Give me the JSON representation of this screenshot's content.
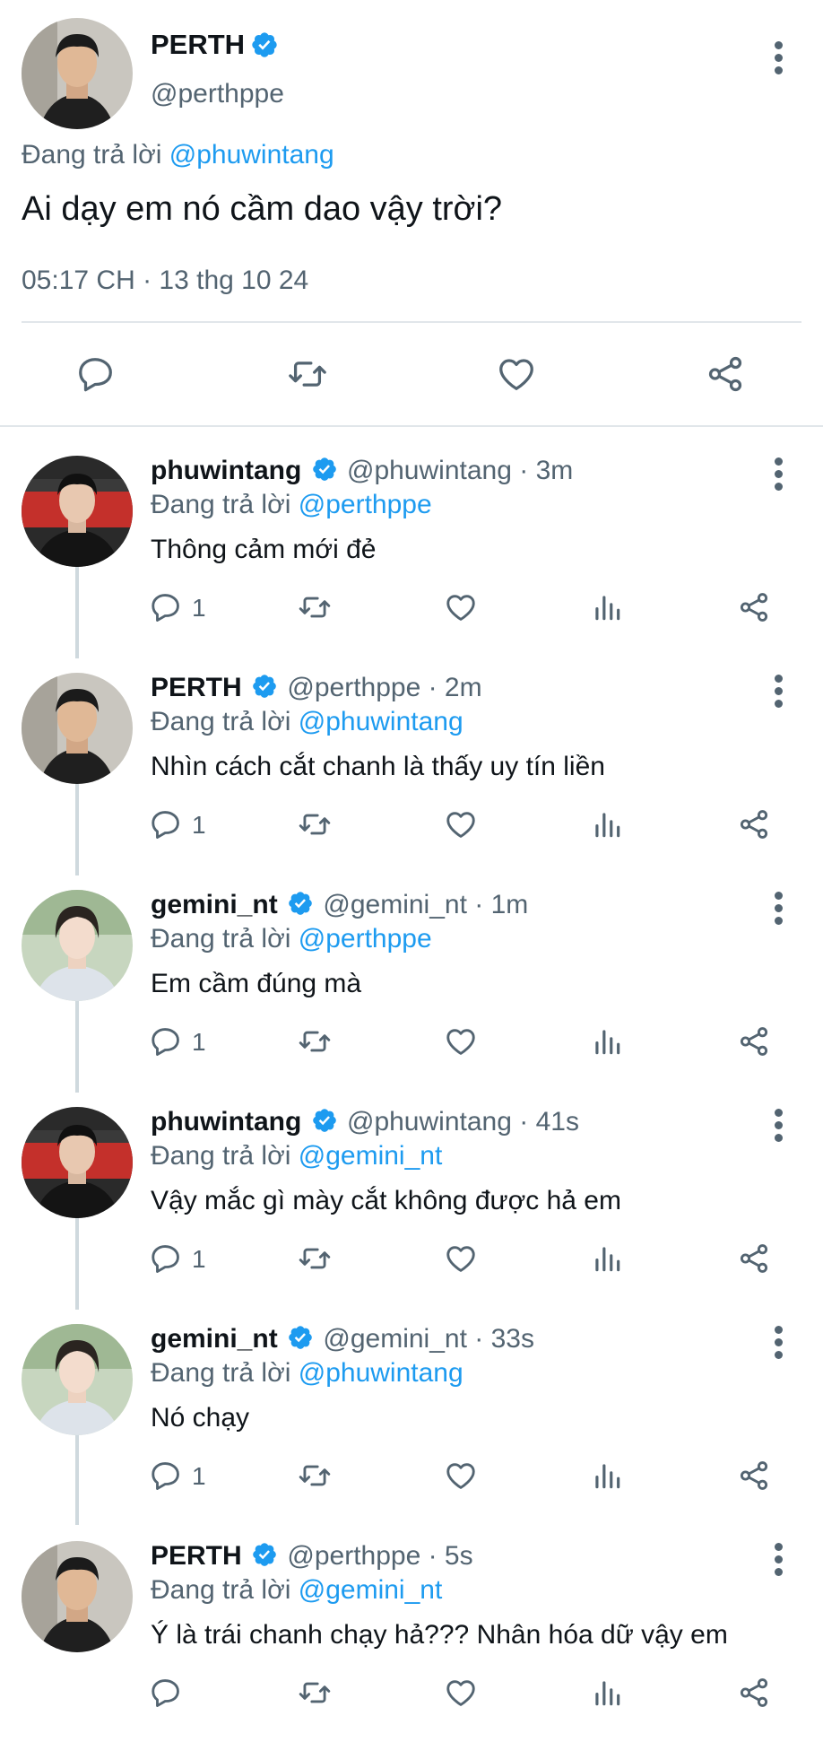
{
  "main": {
    "name": "PERTH",
    "handle": "@perthppe",
    "reply_prefix": "Đang trả lời",
    "reply_to": "@phuwintang",
    "text": "Ai dạy em nó cầm dao vậy trời?",
    "timestamp": "05:17 CH · 13 thg 10 24"
  },
  "replies": [
    {
      "name": "phuwintang",
      "handle": "@phuwintang",
      "time": "· 3m",
      "reply_prefix": "Đang trả lời",
      "reply_to": "@perthppe",
      "text": "Thông cảm mới đẻ",
      "reply_count": "1",
      "avatar": "phuwin"
    },
    {
      "name": "PERTH",
      "handle": "@perthppe",
      "time": "· 2m",
      "reply_prefix": "Đang trả lời",
      "reply_to": "@phuwintang",
      "text": "Nhìn cách cắt chanh là thấy uy tín liền",
      "reply_count": "1",
      "avatar": "perth"
    },
    {
      "name": "gemini_nt",
      "handle": "@gemini_nt",
      "time": "· 1m",
      "reply_prefix": "Đang trả lời",
      "reply_to": "@perthppe",
      "text": "Em cầm đúng mà",
      "reply_count": "1",
      "avatar": "gemini"
    },
    {
      "name": "phuwintang",
      "handle": "@phuwintang",
      "time": "· 41s",
      "reply_prefix": "Đang trả lời",
      "reply_to": "@gemini_nt",
      "text": "Vậy mắc gì mày cắt không được hả em",
      "reply_count": "1",
      "avatar": "phuwin"
    },
    {
      "name": "gemini_nt",
      "handle": "@gemini_nt",
      "time": "· 33s",
      "reply_prefix": "Đang trả lời",
      "reply_to": "@phuwintang",
      "text": "Nó chạy",
      "reply_count": "1",
      "avatar": "gemini"
    },
    {
      "name": "PERTH",
      "handle": "@perthppe",
      "time": "· 5s",
      "reply_prefix": "Đang trả lời",
      "reply_to": "@gemini_nt",
      "text": "Ý là trái chanh chạy hả??? Nhân hóa dữ vậy em",
      "reply_count": "",
      "avatar": "perth"
    }
  ],
  "colors": {
    "accent": "#1d9bf0",
    "text": "#0f1419",
    "muted": "#536471",
    "divider": "#cfd9de"
  },
  "icons": [
    "reply-icon",
    "retweet-icon",
    "like-icon",
    "views-icon",
    "share-icon",
    "verified-icon",
    "more-icon"
  ]
}
